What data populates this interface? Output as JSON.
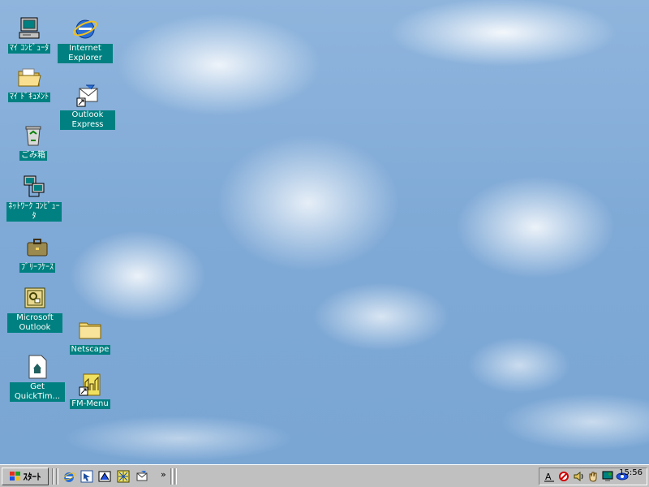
{
  "desktop": {
    "icons": [
      {
        "label": "ﾏｲ ｺﾝﾋﾟｭｰﾀ",
        "icon": "computer-icon"
      },
      {
        "label": "Internet Explorer",
        "icon": "ie-icon"
      },
      {
        "label": "ﾏｲ ﾄﾞｷｭﾒﾝﾄ",
        "icon": "folder-open-icon"
      },
      {
        "label": "Outlook Express",
        "icon": "outlook-express-icon"
      },
      {
        "label": "ごみ箱",
        "icon": "recycle-bin-icon"
      },
      {
        "label": "ﾈｯﾄﾜｰｸ ｺﾝﾋﾟｭｰﾀ",
        "icon": "network-icon"
      },
      {
        "label": "ﾌﾞﾘｰﾌｹｰｽ",
        "icon": "briefcase-icon"
      },
      {
        "label": "Microsoft Outlook",
        "icon": "outlook-icon"
      },
      {
        "label": "Netscape",
        "icon": "folder-icon"
      },
      {
        "label": "Get QuickTim...",
        "icon": "quicktime-doc-icon"
      },
      {
        "label": "FM-Menu",
        "icon": "fm-menu-icon"
      }
    ]
  },
  "taskbar": {
    "start_label": "ｽﾀｰﾄ",
    "quicklaunch_more": "»",
    "clock": "15:56"
  }
}
